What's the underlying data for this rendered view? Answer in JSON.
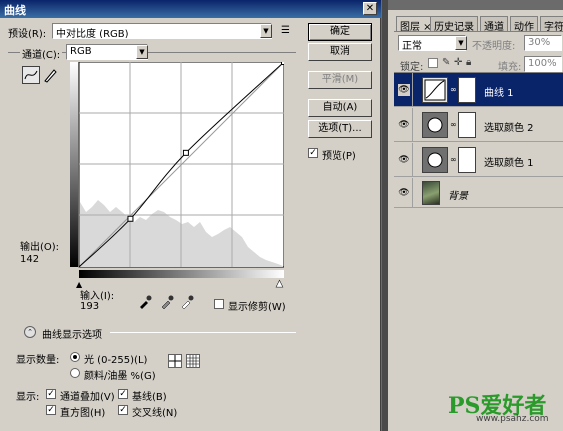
{
  "dialog": {
    "title": "曲线",
    "preset_label": "预设(R):",
    "preset_value": "中对比度 (RGB)",
    "channel_label": "通道(C):",
    "channel_value": "RGB",
    "output_label": "输出(O):",
    "output_value": "142",
    "input_label": "输入(I):",
    "input_value": "193",
    "show_clipping_label": "显示修剪(W)",
    "curve_options_label": "曲线显示选项",
    "show_amount_label": "显示数量:",
    "light_label": "光 (0-255)(L)",
    "pigment_label": "颜料/油墨 %(G)",
    "show_label": "显示:",
    "channel_overlays_label": "通道叠加(V)",
    "baseline_label": "基线(B)",
    "histogram_label": "直方图(H)",
    "intersection_label": "交叉线(N)",
    "buttons": {
      "ok": "确定",
      "cancel": "取消",
      "smooth": "平滑(M)",
      "auto": "自动(A)",
      "options": "选项(T)...",
      "preview": "预览(P)"
    },
    "icons": {
      "curve_tool": "curve-point-icon",
      "pencil_tool": "pencil-icon",
      "black_eyedropper": "eyedropper-black-icon",
      "gray_eyedropper": "eyedropper-gray-icon",
      "white_eyedropper": "eyedropper-white-icon"
    },
    "curve": {
      "points": [
        [
          0,
          0
        ],
        [
          64,
          60
        ],
        [
          133,
          142
        ],
        [
          255,
          255
        ]
      ],
      "input": 193,
      "output": 142
    }
  },
  "layers_panel": {
    "tabs": [
      "图层",
      "历史记录",
      "通道",
      "动作",
      "字符"
    ],
    "blend_mode": "正常",
    "opacity_label": "不透明度:",
    "opacity_value": "30%",
    "lock_label": "锁定:",
    "fill_label": "填充:",
    "fill_value": "100%",
    "layers": [
      {
        "name": "曲线 1",
        "selected": true
      },
      {
        "name": "选取颜色 2",
        "selected": false
      },
      {
        "name": "选取颜色 1",
        "selected": false
      },
      {
        "name": "背景",
        "selected": false
      }
    ]
  },
  "watermark": {
    "brand": "PS爱好者",
    "site": "www.psahz.com"
  },
  "colors": {
    "titlebar": "#0a246a",
    "selected_layer": "#0a246a",
    "watermark": "#2a9a2a"
  }
}
